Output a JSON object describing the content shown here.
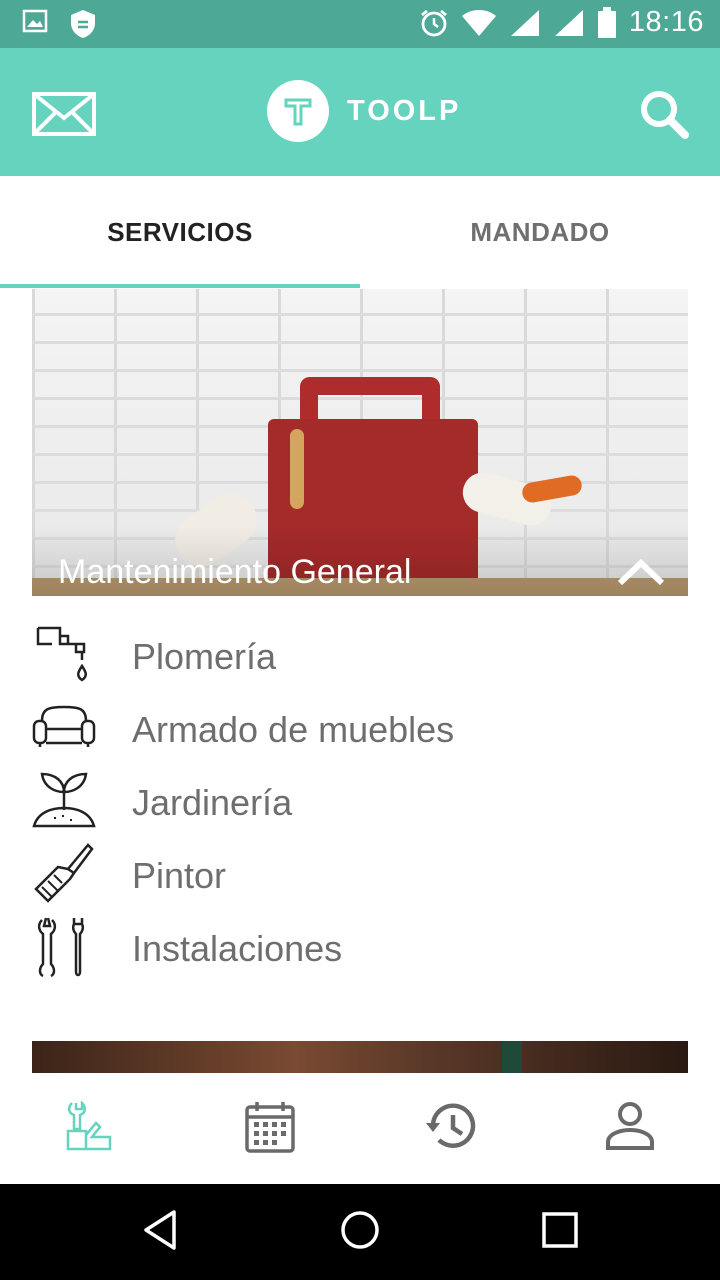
{
  "status_bar": {
    "time": "18:16",
    "icons": [
      "image-icon",
      "shield-icon",
      "alarm-icon",
      "wifi-icon",
      "signal-icon",
      "signal-icon",
      "battery-icon"
    ]
  },
  "app_bar": {
    "logo_letter": "T",
    "brand": "TOOLP",
    "left_icon": "mail-icon",
    "right_icon": "search-icon",
    "accent_color": "#66d3bf",
    "status_color": "#4da996"
  },
  "tabs": [
    {
      "label": "SERVICIOS",
      "active": true
    },
    {
      "label": "MANDADO",
      "active": false
    }
  ],
  "category": {
    "title": "Mantenimiento General",
    "expanded": true,
    "items": [
      {
        "label": "Plomería",
        "icon": "faucet-icon"
      },
      {
        "label": "Armado de muebles",
        "icon": "sofa-icon"
      },
      {
        "label": "Jardinería",
        "icon": "sprout-icon"
      },
      {
        "label": "Pintor",
        "icon": "paintbrush-icon"
      },
      {
        "label": "Instalaciones",
        "icon": "tools-icon"
      }
    ]
  },
  "bottom_nav": [
    {
      "icon": "services-icon",
      "active": true
    },
    {
      "icon": "calendar-icon",
      "active": false
    },
    {
      "icon": "history-icon",
      "active": false
    },
    {
      "icon": "profile-icon",
      "active": false
    }
  ],
  "system_nav": [
    "back-icon",
    "home-icon",
    "recents-icon"
  ]
}
